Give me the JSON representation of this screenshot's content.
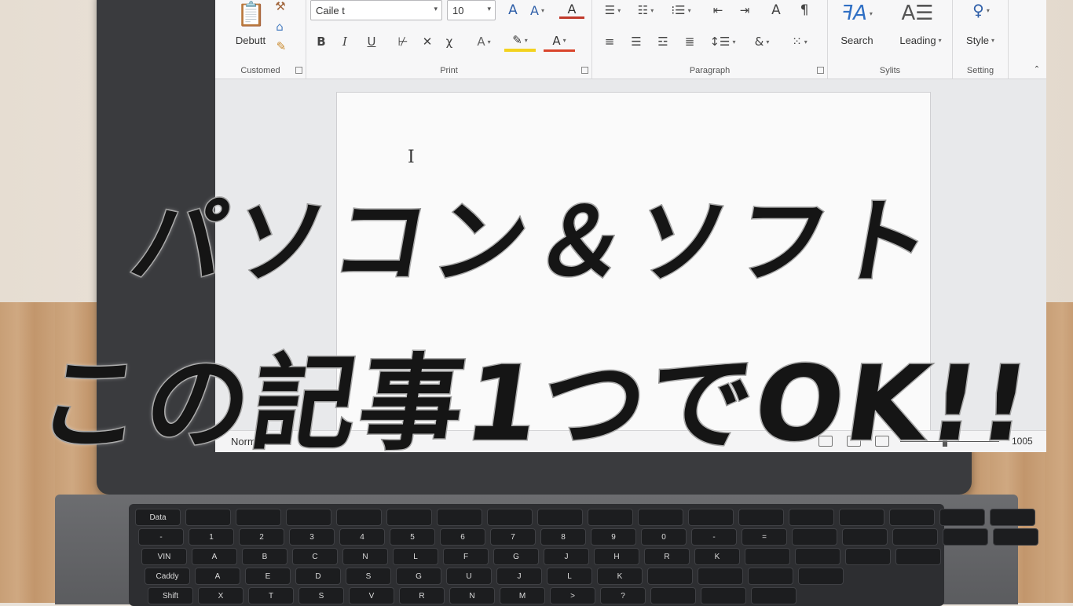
{
  "ribbon": {
    "customed": {
      "label": "Customed",
      "button": "Debutt",
      "icons": [
        "clipboard-icon",
        "wrench-icon",
        "house-icon",
        "paint-brush-icon"
      ]
    },
    "print": {
      "label": "Print",
      "font_name": "Caile t",
      "font_size": "10",
      "bold": "B",
      "italic": "I",
      "underline": "U",
      "icons": [
        "grow-font-icon",
        "shrink-font-icon",
        "font-color-icon",
        "strikethrough-icon",
        "clear-format-icon",
        "subscript-icon",
        "text-effect-icon",
        "highlight-icon",
        "font-color-2-icon"
      ]
    },
    "paragraph": {
      "label": "Paragraph",
      "icons": [
        "bullets-icon",
        "numbering-icon",
        "multilevel-icon",
        "decrease-indent-icon",
        "increase-indent-icon",
        "sort-icon",
        "pilcrow-icon",
        "align-left-icon",
        "align-center-icon",
        "align-right-icon",
        "justify-icon",
        "line-spacing-icon",
        "shading-icon",
        "borders-icon"
      ]
    },
    "styles": {
      "label": "Sylits",
      "search": "Search",
      "leading": "Leading"
    },
    "setting": {
      "label": "Setting",
      "style": "Style"
    }
  },
  "status": {
    "mode": "Normal",
    "zoom": "1005"
  },
  "keyboard": {
    "rows": [
      [
        "Data",
        "",
        "",
        "",
        "",
        "",
        "",
        "",
        "",
        "",
        "",
        "",
        "",
        "",
        "",
        "",
        "",
        ""
      ],
      [
        "-",
        "1",
        "2",
        "3",
        "4",
        "5",
        "6",
        "7",
        "8",
        "9",
        "0",
        "-",
        "=",
        "",
        "",
        "",
        "",
        ""
      ],
      [
        "VIN",
        "A",
        "B",
        "C",
        "N",
        "L",
        "F",
        "G",
        "J",
        "H",
        "R",
        "K",
        "",
        "",
        "",
        ""
      ],
      [
        "Caddy",
        "A",
        "E",
        "D",
        "S",
        "G",
        "U",
        "J",
        "L",
        "K",
        "",
        "",
        "",
        ""
      ],
      [
        "Shift",
        "X",
        "T",
        "S",
        "V",
        "R",
        "N",
        "M",
        ">",
        "?",
        "",
        "",
        ""
      ]
    ]
  },
  "headline": {
    "line1": "パソコン＆ソフト",
    "line2": "この記事1つでOK!!"
  }
}
